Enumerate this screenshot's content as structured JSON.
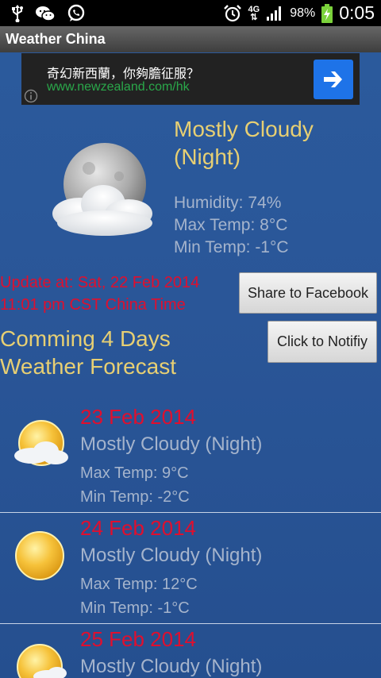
{
  "status_bar": {
    "network": "4G",
    "battery": "98%",
    "time": "0:05"
  },
  "app": {
    "title": "Weather China"
  },
  "ad": {
    "title": "奇幻新西蘭，你夠膽征服？",
    "url": "www.newzealand.com/hk",
    "cta_icon": "arrow-right-icon",
    "info_icon": "info-icon"
  },
  "current": {
    "condition_line1": "Mostly Cloudy",
    "condition_line2": "(Night)",
    "humidity": "Humidity: 74%",
    "max_temp": "Max Temp: 8°C",
    "min_temp": "Min Temp: -1°C",
    "icon": "moon-cloud-icon"
  },
  "update": {
    "line1": "Update at: Sat, 22 Feb 2014",
    "line2": "11:01 pm CST China Time"
  },
  "buttons": {
    "share": "Share to Facebook",
    "notify": "Click to Notifiy"
  },
  "forecast_heading": {
    "line1": "Comming 4 Days",
    "line2": "Weather Forecast"
  },
  "forecast": [
    {
      "date": "23 Feb 2014",
      "condition": "Mostly Cloudy (Night)",
      "max": "Max Temp: 9°C",
      "min": "Min Temp: -2°C",
      "icon": "sun-cloud-icon"
    },
    {
      "date": "24 Feb 2014",
      "condition": "Mostly Cloudy (Night)",
      "max": "Max Temp: 12°C",
      "min": "Min Temp: -1°C",
      "icon": "sun-icon"
    },
    {
      "date": "25 Feb 2014",
      "condition": "Mostly Cloudy (Night)",
      "max": "",
      "min": "",
      "icon": "sun-cloud-icon"
    }
  ],
  "colors": {
    "background": "#2a5596",
    "heading_yellow": "#e7cf73",
    "date_red": "#e00f2e",
    "muted_text": "#a5b4cc",
    "ad_url_green": "#2aa84a",
    "ad_button_blue": "#1e73e8"
  }
}
